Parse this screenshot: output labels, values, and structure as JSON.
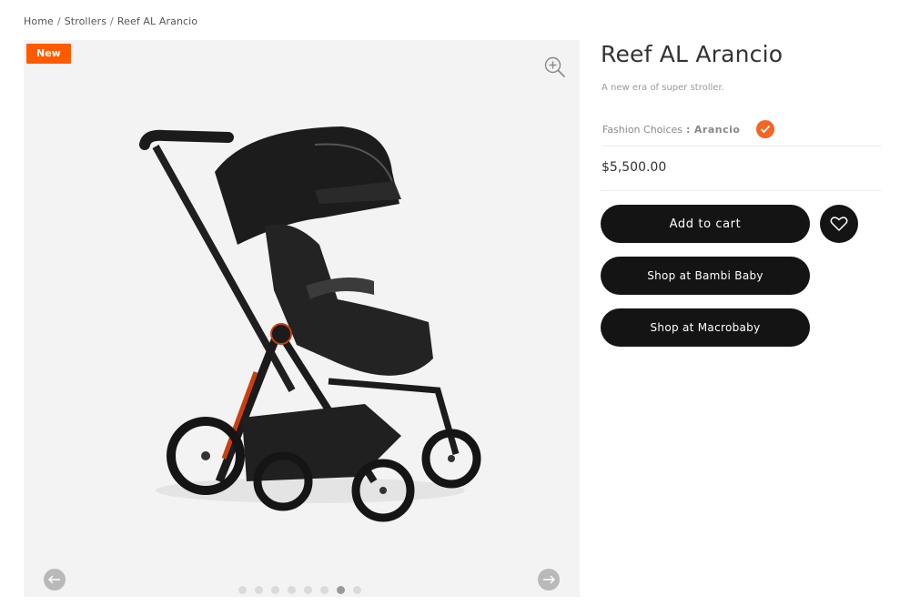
{
  "breadcrumb": {
    "items": [
      "Home",
      "Strollers",
      "Reef AL Arancio"
    ],
    "separator": "/"
  },
  "gallery": {
    "badge": "New",
    "zoom_icon": "zoom-in-icon",
    "prev_icon": "arrow-left-icon",
    "next_icon": "arrow-right-icon",
    "dots_total": 8,
    "active_dot": 7
  },
  "product": {
    "title": "Reef AL Arancio",
    "subtitle": "A new era of super stroller.",
    "choice_label": "Fashion Choices",
    "choice_separator": ":",
    "choice_value": "Arancio",
    "swatch_color": "#f26522",
    "price": "$5,500.00"
  },
  "actions": {
    "add_to_cart": "Add to cart",
    "shop_bambi": "Shop at Bambi Baby",
    "shop_macro": "Shop at Macrobaby",
    "wishlist_icon": "heart-icon"
  },
  "colors": {
    "badge": "#ff5a00",
    "accent": "#f26522",
    "button": "#141414",
    "gallery_bg": "#f3f3f3"
  }
}
